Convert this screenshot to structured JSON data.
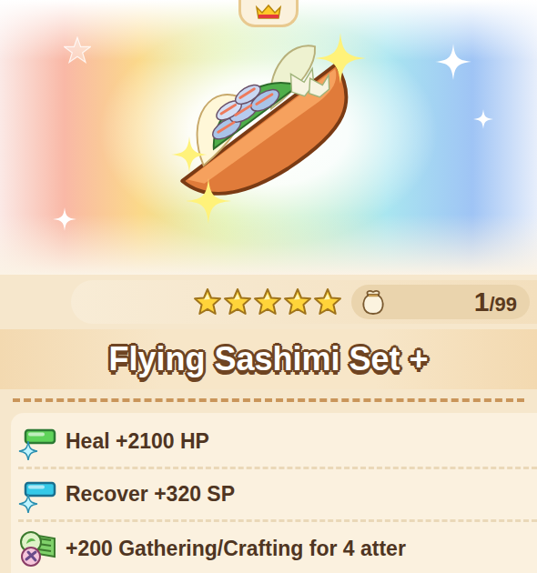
{
  "item": {
    "name": "Flying Sashimi Set +",
    "stars": 5,
    "quantity": "1",
    "capacity": "/99",
    "effects": [
      {
        "text": "Heal +2100 HP",
        "kind": "hp"
      },
      {
        "text": "Recover +320 SP",
        "kind": "sp"
      },
      {
        "text": "+200 Gathering/Crafting for 4 atter",
        "kind": "buff"
      }
    ]
  }
}
